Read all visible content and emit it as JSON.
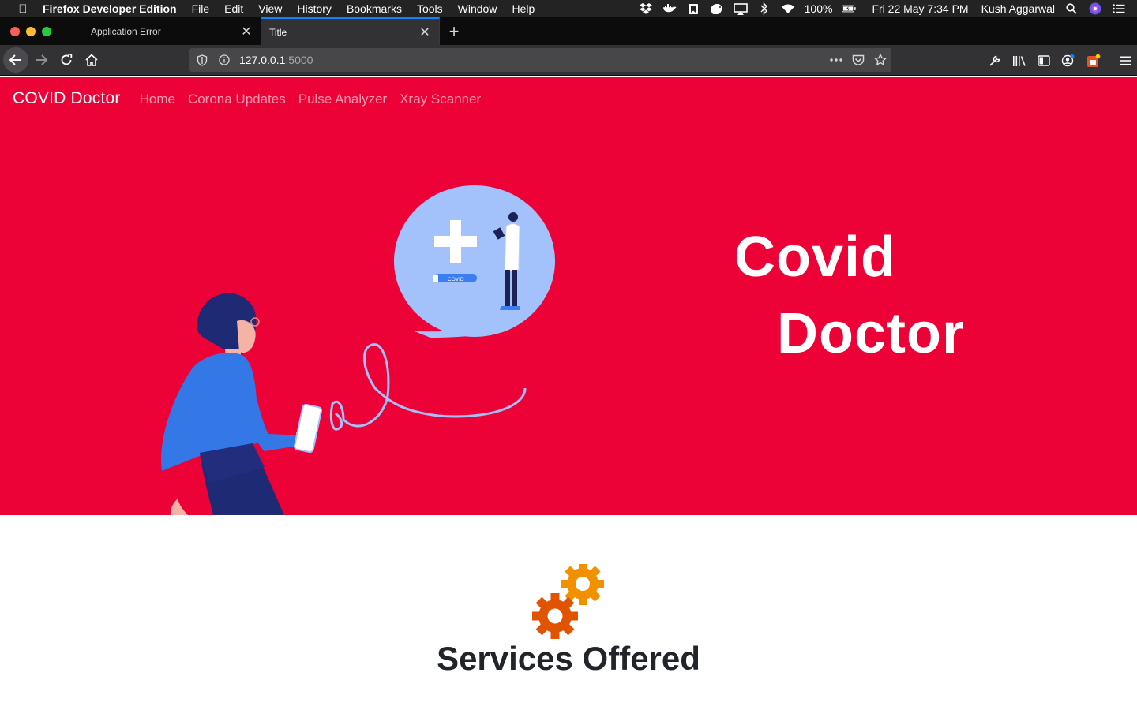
{
  "menubar": {
    "app_name": "Firefox Developer Edition",
    "menus": [
      "File",
      "Edit",
      "View",
      "History",
      "Bookmarks",
      "Tools",
      "Window",
      "Help"
    ],
    "battery": "100%",
    "datetime": "Fri 22 May  7:34 PM",
    "user": "Kush Aggarwal"
  },
  "tabs": [
    {
      "title": "Application Error",
      "active": false
    },
    {
      "title": "Title",
      "active": true
    }
  ],
  "urlbar": {
    "host": "127.0.0.1",
    "port": ":5000"
  },
  "navbar": {
    "brand": "COVID Doctor",
    "links": [
      "Home",
      "Corona Updates",
      "Pulse Analyzer",
      "Xray Scanner"
    ]
  },
  "hero": {
    "title_line1": "Covid",
    "title_line2": "Doctor",
    "illustration_label": "COVID"
  },
  "services": {
    "title": "Services Offered"
  },
  "colors": {
    "hero_bg": "#ec0236",
    "accent_tab": "#0a84ff",
    "gear_orange": "#f29100",
    "gear_red": "#e05300"
  }
}
